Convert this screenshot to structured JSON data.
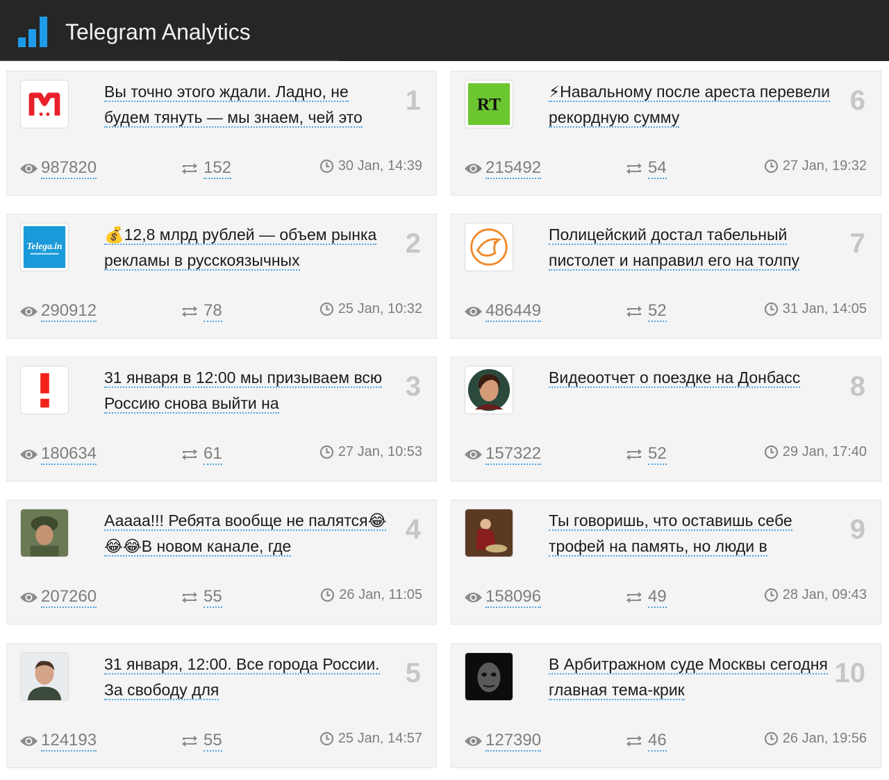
{
  "header": {
    "title": "Telegram Analytics",
    "accent": "#1e9be8"
  },
  "posts": [
    {
      "rank": "1",
      "text": "Вы точно этого ждали. Ладно, не будем тянуть — мы знаем, чей это",
      "views": "987820",
      "shares": "152",
      "time": "30 Jan, 14:39",
      "avatar_icon": "m-logo-icon"
    },
    {
      "rank": "6",
      "text": "⚡Навальному после ареста перевели рекордную сумму",
      "views": "215492",
      "shares": "54",
      "time": "27 Jan, 19:32",
      "avatar_icon": "rt-logo-icon",
      "avatar_text": "RT"
    },
    {
      "rank": "2",
      "text": "💰12,8 млрд рублей — объем рынка рекламы в русскоязычных",
      "views": "290912",
      "shares": "78",
      "time": "25 Jan, 10:32",
      "avatar_icon": "telega-logo-icon",
      "avatar_text": "Telega.in"
    },
    {
      "rank": "7",
      "text": "Полицейский достал табельный пистолет и направил его на толпу",
      "views": "486449",
      "shares": "52",
      "time": "31 Jan, 14:05",
      "avatar_icon": "bird-logo-icon"
    },
    {
      "rank": "3",
      "text": "31 января в 12:00 мы призываем всю Россию снова выйти на",
      "views": "180634",
      "shares": "61",
      "time": "27 Jan, 10:53",
      "avatar_icon": "exclamation-logo-icon"
    },
    {
      "rank": "8",
      "text": "Видеоотчет о поездке на Донбасс",
      "views": "157322",
      "shares": "52",
      "time": "29 Jan, 17:40",
      "avatar_icon": "woman-portrait-icon"
    },
    {
      "rank": "4",
      "text": "Ааааа!!! Ребята вообще не палятся😂😂😂В новом канале, где",
      "views": "207260",
      "shares": "55",
      "time": "26 Jan, 11:05",
      "avatar_icon": "soldier-portrait-icon"
    },
    {
      "rank": "9",
      "text": "Ты говоришь, что оставишь себе трофей на память, но люди в",
      "views": "158096",
      "shares": "49",
      "time": "28 Jan, 09:43",
      "avatar_icon": "painting-portrait-icon"
    },
    {
      "rank": "5",
      "text": "31 января, 12:00. Все города России. За свободу для",
      "views": "124193",
      "shares": "55",
      "time": "25 Jan, 14:57",
      "avatar_icon": "man-portrait-icon"
    },
    {
      "rank": "10",
      "text": "В Арбитражном суде Москвы сегодня главная тема-крик",
      "views": "127390",
      "shares": "46",
      "time": "26 Jan, 19:56",
      "avatar_icon": "dark-face-portrait-icon"
    }
  ]
}
